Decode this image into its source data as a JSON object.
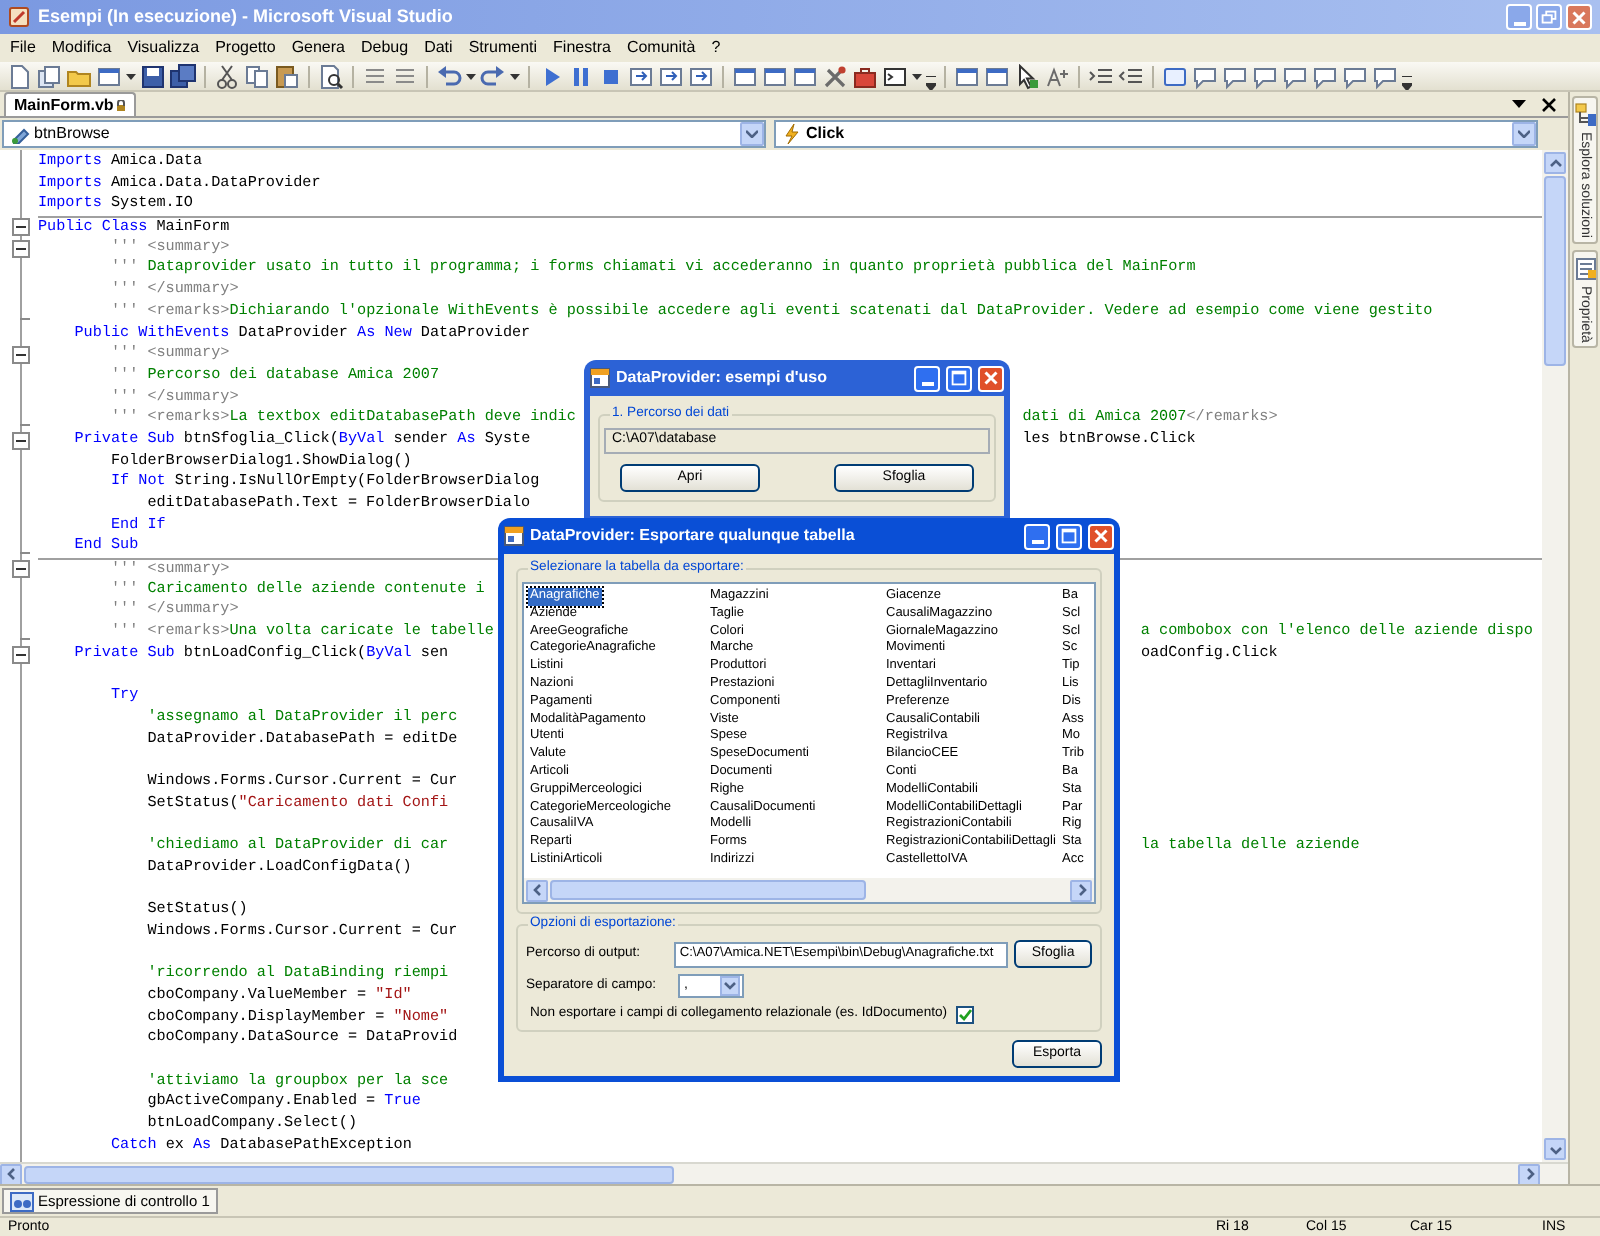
{
  "window": {
    "title": "Esempi (In esecuzione) - Microsoft Visual Studio"
  },
  "menu": [
    "File",
    "Modifica",
    "Visualizza",
    "Progetto",
    "Genera",
    "Debug",
    "Dati",
    "Strumenti",
    "Finestra",
    "Comunità",
    "?"
  ],
  "document_tabs": [
    {
      "label": "MainForm.vb",
      "selected": true
    }
  ],
  "member_bar": {
    "object": "btnBrowse",
    "event": "Click"
  },
  "side_tabs": [
    "Esplora soluzioni",
    "Proprietà"
  ],
  "code_lines": [
    {
      "kind": "plain",
      "rule": false,
      "segments": [
        [
          {
            "kind": "keyword",
            "text": "Imports"
          },
          {
            "kind": "plain",
            "text": " Amica.Data"
          }
        ]
      ]
    },
    {
      "kind": "plain",
      "rule": false,
      "segments": [
        [
          {
            "kind": "keyword",
            "text": "Imports"
          },
          {
            "kind": "plain",
            "text": " Amica.Data.DataProvider"
          }
        ]
      ]
    },
    {
      "kind": "plain",
      "rule": false,
      "segments": [
        [
          {
            "kind": "keyword",
            "text": "Imports"
          },
          {
            "kind": "plain",
            "text": " System.IO"
          }
        ]
      ]
    },
    {
      "kind": "fold_start",
      "rule": true,
      "segments": [
        [
          {
            "kind": "keyword",
            "text": "Public Class"
          },
          {
            "kind": "plain",
            "text": " MainForm"
          }
        ]
      ]
    },
    {
      "kind": "fold_start",
      "rule": false,
      "segments": [
        [
          {
            "kind": "doc",
            "text": "        ''' <summary>"
          }
        ]
      ]
    },
    {
      "kind": "plain",
      "rule": false,
      "segments": [
        [
          {
            "kind": "doc",
            "text": "        ''' "
          },
          {
            "kind": "comment",
            "text": "Dataprovider usato in tutto il programma; i forms chiamati vi accederanno in quanto proprietà pubblica del MainForm"
          }
        ]
      ]
    },
    {
      "kind": "plain",
      "rule": false,
      "segments": [
        [
          {
            "kind": "doc",
            "text": "        ''' </summary>"
          }
        ]
      ]
    },
    {
      "kind": "fold_end",
      "rule": false,
      "segments": [
        [
          {
            "kind": "doc",
            "text": "        ''' <remarks>"
          },
          {
            "kind": "comment",
            "text": "Dichiarando l'opzionale WithEvents è possibile accedere agli eventi scatenati dal DataProvider. Vedere ad esempio come viene gestito"
          }
        ]
      ]
    },
    {
      "kind": "plain",
      "rule": false,
      "segments": [
        [
          {
            "kind": "keyword",
            "text": "    Public WithEvents"
          },
          {
            "kind": "plain",
            "text": " DataProvider "
          },
          {
            "kind": "keyword",
            "text": "As New"
          },
          {
            "kind": "plain",
            "text": " DataProvider"
          }
        ]
      ]
    },
    {
      "kind": "fold_start",
      "rule": false,
      "segments": [
        [
          {
            "kind": "doc",
            "text": "        ''' <summary>"
          }
        ]
      ]
    },
    {
      "kind": "plain",
      "rule": false,
      "segments": [
        [
          {
            "kind": "doc",
            "text": "        ''' "
          },
          {
            "kind": "comment",
            "text": "Percorso dei database Amica 2007"
          }
        ]
      ]
    },
    {
      "kind": "plain",
      "rule": false,
      "segments": [
        [
          {
            "kind": "doc",
            "text": "        ''' </summary>"
          }
        ]
      ]
    },
    {
      "kind": "fold_end",
      "rule": false,
      "segments": [
        [
          {
            "kind": "doc",
            "text": "        ''' <remarks>"
          },
          {
            "kind": "comment",
            "text": "La textbox editDatabasePath deve indic"
          }
        ],
        [
          {
            "kind": "comment",
            "text": "                                                 dati di Amica 2007"
          },
          {
            "kind": "doc",
            "text": "</remarks>"
          }
        ]
      ]
    },
    {
      "kind": "fold_start",
      "rule": false,
      "segments": [
        [
          {
            "kind": "keyword",
            "text": "    Private Sub"
          },
          {
            "kind": "plain",
            "text": " btnSfoglia_Click("
          },
          {
            "kind": "keyword",
            "text": "ByVal"
          },
          {
            "kind": "plain",
            "text": " sender "
          },
          {
            "kind": "keyword",
            "text": "As"
          },
          {
            "kind": "plain",
            "text": " Syste"
          }
        ],
        [
          {
            "kind": "plain",
            "text": "                                                      les btnBrowse.Click"
          }
        ]
      ]
    },
    {
      "kind": "plain",
      "rule": false,
      "segments": [
        [
          {
            "kind": "plain",
            "text": "        FolderBrowserDialog1.ShowDialog()"
          }
        ]
      ]
    },
    {
      "kind": "plain",
      "rule": false,
      "segments": [
        [
          {
            "kind": "keyword",
            "text": "        If Not"
          },
          {
            "kind": "plain",
            "text": " String.IsNullOrEmpty(FolderBrowserDialog"
          }
        ]
      ]
    },
    {
      "kind": "plain",
      "rule": false,
      "segments": [
        [
          {
            "kind": "plain",
            "text": "            editDatabasePath.Text = FolderBrowserDialo"
          }
        ]
      ]
    },
    {
      "kind": "plain",
      "rule": false,
      "segments": [
        [
          {
            "kind": "keyword",
            "text": "        End If"
          }
        ]
      ]
    },
    {
      "kind": "fold_end",
      "rule": false,
      "segments": [
        [
          {
            "kind": "keyword",
            "text": "    End Sub"
          }
        ]
      ]
    },
    {
      "kind": "fold_start",
      "rule": true,
      "segments": [
        [
          {
            "kind": "doc",
            "text": "        ''' <summary>"
          }
        ]
      ]
    },
    {
      "kind": "plain",
      "rule": false,
      "segments": [
        [
          {
            "kind": "doc",
            "text": "        ''' "
          },
          {
            "kind": "comment",
            "text": "Caricamento delle aziende contenute i"
          }
        ]
      ]
    },
    {
      "kind": "plain",
      "rule": false,
      "segments": [
        [
          {
            "kind": "doc",
            "text": "        ''' </summary>"
          }
        ]
      ]
    },
    {
      "kind": "fold_end",
      "rule": false,
      "segments": [
        [
          {
            "kind": "doc",
            "text": "        ''' <remarks>"
          },
          {
            "kind": "comment",
            "text": "Una volta caricate le tabelle"
          }
        ],
        [
          {
            "kind": "comment",
            "text": "                                                                       a combobox con l'elenco delle aziende dispo"
          }
        ]
      ]
    },
    {
      "kind": "fold_start",
      "rule": false,
      "segments": [
        [
          {
            "kind": "keyword",
            "text": "    Private Sub"
          },
          {
            "kind": "plain",
            "text": " btnLoadConfig_Click("
          },
          {
            "kind": "keyword",
            "text": "ByVal"
          },
          {
            "kind": "plain",
            "text": " sen"
          }
        ],
        [
          {
            "kind": "plain",
            "text": "                                                                            oadConfig.Click"
          }
        ]
      ]
    },
    {
      "kind": "plain",
      "rule": false
    },
    {
      "kind": "plain",
      "rule": false,
      "segments": [
        [
          {
            "kind": "keyword",
            "text": "        Try"
          }
        ]
      ]
    },
    {
      "kind": "plain",
      "rule": false,
      "segments": [
        [
          {
            "kind": "comment",
            "text": "            'assegnamo al DataProvider il perc"
          }
        ]
      ]
    },
    {
      "kind": "plain",
      "rule": false,
      "segments": [
        [
          {
            "kind": "plain",
            "text": "            DataProvider.DatabasePath = editDe"
          }
        ]
      ]
    },
    {
      "kind": "plain",
      "rule": false
    },
    {
      "kind": "plain",
      "rule": false,
      "segments": [
        [
          {
            "kind": "plain",
            "text": "            Windows.Forms.Cursor.Current = Cur"
          }
        ]
      ]
    },
    {
      "kind": "plain",
      "rule": false,
      "segments": [
        [
          {
            "kind": "plain",
            "text": "            SetStatus("
          },
          {
            "kind": "string",
            "text": "\"Caricamento dati Confi"
          }
        ]
      ]
    },
    {
      "kind": "plain",
      "rule": false
    },
    {
      "kind": "plain",
      "rule": false,
      "segments": [
        [
          {
            "kind": "comment",
            "text": "            'chiediamo al DataProvider di car"
          }
        ],
        [
          {
            "kind": "comment",
            "text": "                                                                            la tabella delle aziende"
          }
        ]
      ]
    },
    {
      "kind": "plain",
      "rule": false,
      "segments": [
        [
          {
            "kind": "plain",
            "text": "            DataProvider.LoadConfigData()"
          }
        ]
      ]
    },
    {
      "kind": "plain",
      "rule": false
    },
    {
      "kind": "plain",
      "rule": false,
      "segments": [
        [
          {
            "kind": "plain",
            "text": "            SetStatus()"
          }
        ]
      ]
    },
    {
      "kind": "plain",
      "rule": false,
      "segments": [
        [
          {
            "kind": "plain",
            "text": "            Windows.Forms.Cursor.Current = Cur"
          }
        ]
      ]
    },
    {
      "kind": "plain",
      "rule": false
    },
    {
      "kind": "plain",
      "rule": false,
      "segments": [
        [
          {
            "kind": "comment",
            "text": "            'ricorrendo al DataBinding riempi"
          }
        ]
      ]
    },
    {
      "kind": "plain",
      "rule": false,
      "segments": [
        [
          {
            "kind": "plain",
            "text": "            cboCompany.ValueMember = "
          },
          {
            "kind": "string",
            "text": "\"Id\""
          }
        ]
      ]
    },
    {
      "kind": "plain",
      "rule": false,
      "segments": [
        [
          {
            "kind": "plain",
            "text": "            cboCompany.DisplayMember = "
          },
          {
            "kind": "string",
            "text": "\"Nome\""
          }
        ]
      ]
    },
    {
      "kind": "plain",
      "rule": false,
      "segments": [
        [
          {
            "kind": "plain",
            "text": "            cboCompany.DataSource = DataProvid"
          }
        ]
      ]
    },
    {
      "kind": "plain",
      "rule": false
    },
    {
      "kind": "plain",
      "rule": false,
      "segments": [
        [
          {
            "kind": "comment",
            "text": "            'attiviamo la groupbox per la sce"
          }
        ]
      ]
    },
    {
      "kind": "plain",
      "rule": false,
      "segments": [
        [
          {
            "kind": "plain",
            "text": "            gbActiveCompany.Enabled = "
          },
          {
            "kind": "keyword",
            "text": "True"
          }
        ]
      ]
    },
    {
      "kind": "plain",
      "rule": false,
      "segments": [
        [
          {
            "kind": "plain",
            "text": "            btnLoadCompany.Select()"
          }
        ]
      ]
    },
    {
      "kind": "plain",
      "rule": false,
      "segments": [
        [
          {
            "kind": "keyword",
            "text": "        Catch"
          },
          {
            "kind": "plain",
            "text": " ex "
          },
          {
            "kind": "keyword",
            "text": "As"
          },
          {
            "kind": "plain",
            "text": " DatabasePathException"
          }
        ]
      ]
    }
  ],
  "usage_dialog": {
    "title": "DataProvider: esempi d'uso",
    "group_label": "1. Percorso dei dati",
    "path": "C:\\A07\\database",
    "buttons": [
      "Apri",
      "Sfoglia"
    ]
  },
  "export_dialog": {
    "title": "DataProvider: Esportare qualunque tabella",
    "table_group": "Selezionare la tabella da esportare:",
    "table_columns": [
      [
        {
          "text": "Anagrafiche",
          "selected": true
        },
        {
          "text": "Aziende",
          "selected": false
        },
        {
          "text": "AreeGeografiche",
          "selected": false
        },
        {
          "text": "CategorieAnagrafiche",
          "selected": false
        },
        {
          "text": "Listini",
          "selected": false
        },
        {
          "text": "Nazioni",
          "selected": false
        },
        {
          "text": "Pagamenti",
          "selected": false
        },
        {
          "text": "ModalitàPagamento",
          "selected": false
        },
        {
          "text": "Utenti",
          "selected": false
        },
        {
          "text": "Valute",
          "selected": false
        },
        {
          "text": "Articoli",
          "selected": false
        },
        {
          "text": "GruppiMerceologici",
          "selected": false
        },
        {
          "text": "CategorieMerceologiche",
          "selected": false
        },
        {
          "text": "CausaliIVA",
          "selected": false
        },
        {
          "text": "Reparti",
          "selected": false
        },
        {
          "text": "ListiniArticoli",
          "selected": false
        }
      ],
      [
        {
          "text": "Magazzini",
          "selected": false
        },
        {
          "text": "Taglie",
          "selected": false
        },
        {
          "text": "Colori",
          "selected": false
        },
        {
          "text": "Marche",
          "selected": false
        },
        {
          "text": "Produttori",
          "selected": false
        },
        {
          "text": "Prestazioni",
          "selected": false
        },
        {
          "text": "Componenti",
          "selected": false
        },
        {
          "text": "Viste",
          "selected": false
        },
        {
          "text": "Spese",
          "selected": false
        },
        {
          "text": "SpeseDocumenti",
          "selected": false
        },
        {
          "text": "Documenti",
          "selected": false
        },
        {
          "text": "Righe",
          "selected": false
        },
        {
          "text": "CausaliDocumenti",
          "selected": false
        },
        {
          "text": "Modelli",
          "selected": false
        },
        {
          "text": "Forms",
          "selected": false
        },
        {
          "text": "Indirizzi",
          "selected": false
        }
      ],
      [
        {
          "text": "Giacenze",
          "selected": false
        },
        {
          "text": "CausaliMagazzino",
          "selected": false
        },
        {
          "text": "GiornaleMagazzino",
          "selected": false
        },
        {
          "text": "Movimenti",
          "selected": false
        },
        {
          "text": "Inventari",
          "selected": false
        },
        {
          "text": "DettagliInventario",
          "selected": false
        },
        {
          "text": "Preferenze",
          "selected": false
        },
        {
          "text": "CausaliContabili",
          "selected": false
        },
        {
          "text": "RegistriIva",
          "selected": false
        },
        {
          "text": "BilancioCEE",
          "selected": false
        },
        {
          "text": "Conti",
          "selected": false
        },
        {
          "text": "ModelliContabili",
          "selected": false
        },
        {
          "text": "ModelliContabiliDettagli",
          "selected": false
        },
        {
          "text": "RegistrazioniContabili",
          "selected": false
        },
        {
          "text": "RegistrazioniContabiliDettagli",
          "selected": false
        },
        {
          "text": "CastellettoIVA",
          "selected": false
        }
      ],
      [
        {
          "text": "Ba",
          "selected": false
        },
        {
          "text": "Scl",
          "selected": false
        },
        {
          "text": "Scl",
          "selected": false
        },
        {
          "text": "Sc",
          "selected": false
        },
        {
          "text": "Tip",
          "selected": false
        },
        {
          "text": "Lis",
          "selected": false
        },
        {
          "text": "Dis",
          "selected": false
        },
        {
          "text": "Ass",
          "selected": false
        },
        {
          "text": "Mo",
          "selected": false
        },
        {
          "text": "Trib",
          "selected": false
        },
        {
          "text": "Ba",
          "selected": false
        },
        {
          "text": "Sta",
          "selected": false
        },
        {
          "text": "Par",
          "selected": false
        },
        {
          "text": "Rig",
          "selected": false
        },
        {
          "text": "Sta",
          "selected": false
        },
        {
          "text": "Acc",
          "selected": false
        }
      ]
    ],
    "options_group": "Opzioni di esportazione:",
    "output_label": "Percorso di output:",
    "output_path": "C:\\A07\\Amica.NET\\Esempi\\bin\\Debug\\Anagrafiche.txt",
    "browse_button": "Sfoglia",
    "separator_label": "Separatore di campo:",
    "separator_value": ",",
    "exclude_links": {
      "label": "Non esportare i campi di collegamento relazionale (es. IdDocumento)",
      "checked": true
    },
    "export_button": "Esporta"
  },
  "tool_tabs": [
    {
      "label": "Espressione di controllo 1",
      "selected": true
    }
  ],
  "status_bar": {
    "message": "Pronto",
    "line": "Ri 18",
    "column": "Col 15",
    "character": "Car 15",
    "mode": "INS"
  }
}
